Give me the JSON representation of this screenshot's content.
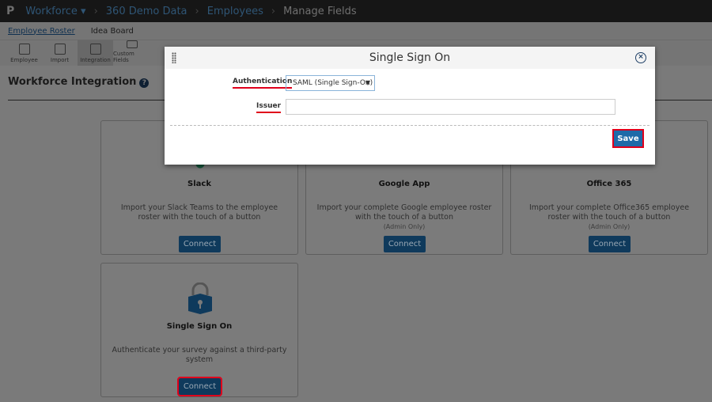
{
  "topbar": {
    "logo": "P",
    "crumbs": [
      "Workforce ▾",
      "360 Demo Data",
      "Employees",
      "Manage Fields"
    ]
  },
  "tabs": [
    "Employee Roster",
    "Idea Board"
  ],
  "toolbar": [
    "Employee",
    "Import",
    "Integration",
    "Custom Fields"
  ],
  "page": {
    "title": "Workforce Integration",
    "help_icon": "?"
  },
  "cards": [
    {
      "title": "Slack",
      "desc": "Import your Slack Teams to the employee roster with the touch of a button",
      "note": "",
      "button": "Connect"
    },
    {
      "title": "Google App",
      "desc": "Import your complete Google employee roster with the touch of a button",
      "note": "(Admin Only)",
      "button": "Connect"
    },
    {
      "title": "Office 365",
      "desc": "Import your complete Office365 employee roster with the touch of a button",
      "note": "(Admin Only)",
      "button": "Connect"
    },
    {
      "title": "Single Sign On",
      "desc": "Authenticate your survey against a third-party system",
      "note": "",
      "button": "Connect"
    }
  ],
  "modal": {
    "title": "Single Sign On",
    "close": "×",
    "auth_label": "Authentication",
    "auth_value": "SAML (Single Sign-On)",
    "issuer_label": "Issuer",
    "issuer_value": "",
    "save": "Save"
  },
  "colors": {
    "accent": "#1e6aa8",
    "highlight": "#e0001b"
  }
}
